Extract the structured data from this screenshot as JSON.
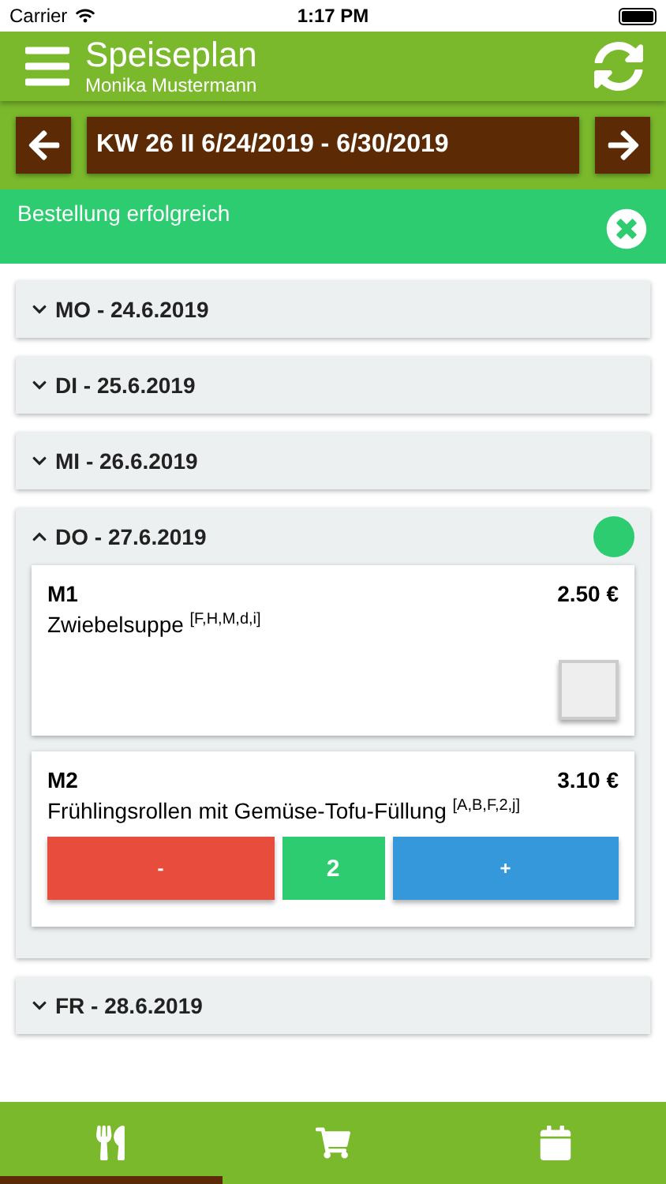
{
  "status_bar": {
    "carrier": "Carrier",
    "time": "1:17 PM"
  },
  "header": {
    "title": "Speiseplan",
    "subtitle": "Monika Mustermann"
  },
  "week": {
    "label": "KW 26 II 6/24/2019 - 6/30/2019"
  },
  "banner": {
    "message": "Bestellung erfolgreich"
  },
  "days": [
    {
      "label": "MO - 24.6.2019",
      "expanded": false,
      "ordered": false
    },
    {
      "label": "DI - 25.6.2019",
      "expanded": false,
      "ordered": false
    },
    {
      "label": "MI - 26.6.2019",
      "expanded": false,
      "ordered": false
    },
    {
      "label": "DO - 27.6.2019",
      "expanded": true,
      "ordered": true,
      "meals": [
        {
          "kind": "checkbox",
          "code": "M1",
          "price": "2.50 €",
          "name": "Zwiebelsuppe $^{[F,H,M,d,i]}$",
          "checked": false
        },
        {
          "kind": "stepper",
          "code": "M2",
          "price": "3.10 €",
          "name": "Frühlingsrollen mit Gemüse-Tofu-Füllung $^{[A,B,F,2,j]}$",
          "minus": "-",
          "quantity": "2",
          "plus": "+"
        }
      ]
    },
    {
      "label": "FR - 28.6.2019",
      "expanded": false,
      "ordered": false
    }
  ],
  "tabs": [
    {
      "kind": "menu",
      "selected": true
    },
    {
      "kind": "cart",
      "selected": false
    },
    {
      "kind": "calendar",
      "selected": false
    }
  ]
}
